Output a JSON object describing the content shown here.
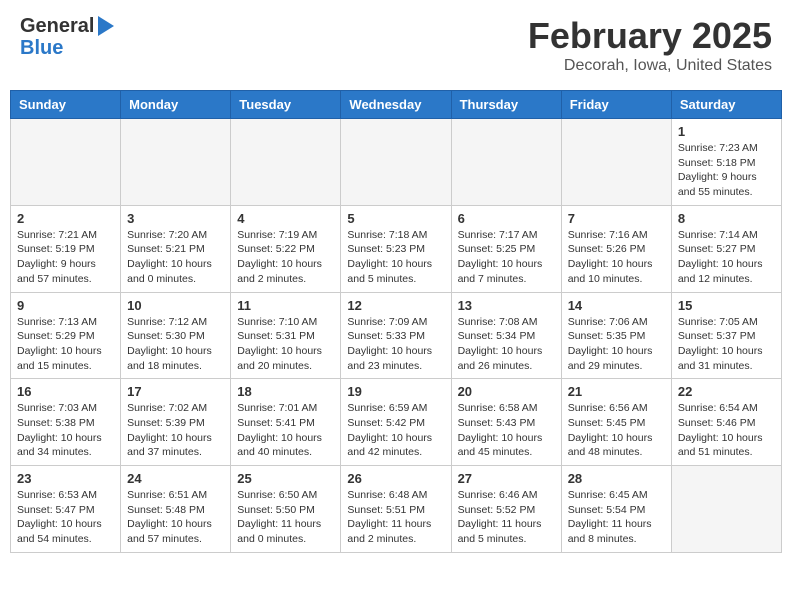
{
  "logo": {
    "line1": "General",
    "line2": "Blue"
  },
  "title": "February 2025",
  "subtitle": "Decorah, Iowa, United States",
  "days_of_week": [
    "Sunday",
    "Monday",
    "Tuesday",
    "Wednesday",
    "Thursday",
    "Friday",
    "Saturday"
  ],
  "weeks": [
    [
      {
        "day": "",
        "info": ""
      },
      {
        "day": "",
        "info": ""
      },
      {
        "day": "",
        "info": ""
      },
      {
        "day": "",
        "info": ""
      },
      {
        "day": "",
        "info": ""
      },
      {
        "day": "",
        "info": ""
      },
      {
        "day": "1",
        "info": "Sunrise: 7:23 AM\nSunset: 5:18 PM\nDaylight: 9 hours\nand 55 minutes."
      }
    ],
    [
      {
        "day": "2",
        "info": "Sunrise: 7:21 AM\nSunset: 5:19 PM\nDaylight: 9 hours\nand 57 minutes."
      },
      {
        "day": "3",
        "info": "Sunrise: 7:20 AM\nSunset: 5:21 PM\nDaylight: 10 hours\nand 0 minutes."
      },
      {
        "day": "4",
        "info": "Sunrise: 7:19 AM\nSunset: 5:22 PM\nDaylight: 10 hours\nand 2 minutes."
      },
      {
        "day": "5",
        "info": "Sunrise: 7:18 AM\nSunset: 5:23 PM\nDaylight: 10 hours\nand 5 minutes."
      },
      {
        "day": "6",
        "info": "Sunrise: 7:17 AM\nSunset: 5:25 PM\nDaylight: 10 hours\nand 7 minutes."
      },
      {
        "day": "7",
        "info": "Sunrise: 7:16 AM\nSunset: 5:26 PM\nDaylight: 10 hours\nand 10 minutes."
      },
      {
        "day": "8",
        "info": "Sunrise: 7:14 AM\nSunset: 5:27 PM\nDaylight: 10 hours\nand 12 minutes."
      }
    ],
    [
      {
        "day": "9",
        "info": "Sunrise: 7:13 AM\nSunset: 5:29 PM\nDaylight: 10 hours\nand 15 minutes."
      },
      {
        "day": "10",
        "info": "Sunrise: 7:12 AM\nSunset: 5:30 PM\nDaylight: 10 hours\nand 18 minutes."
      },
      {
        "day": "11",
        "info": "Sunrise: 7:10 AM\nSunset: 5:31 PM\nDaylight: 10 hours\nand 20 minutes."
      },
      {
        "day": "12",
        "info": "Sunrise: 7:09 AM\nSunset: 5:33 PM\nDaylight: 10 hours\nand 23 minutes."
      },
      {
        "day": "13",
        "info": "Sunrise: 7:08 AM\nSunset: 5:34 PM\nDaylight: 10 hours\nand 26 minutes."
      },
      {
        "day": "14",
        "info": "Sunrise: 7:06 AM\nSunset: 5:35 PM\nDaylight: 10 hours\nand 29 minutes."
      },
      {
        "day": "15",
        "info": "Sunrise: 7:05 AM\nSunset: 5:37 PM\nDaylight: 10 hours\nand 31 minutes."
      }
    ],
    [
      {
        "day": "16",
        "info": "Sunrise: 7:03 AM\nSunset: 5:38 PM\nDaylight: 10 hours\nand 34 minutes."
      },
      {
        "day": "17",
        "info": "Sunrise: 7:02 AM\nSunset: 5:39 PM\nDaylight: 10 hours\nand 37 minutes."
      },
      {
        "day": "18",
        "info": "Sunrise: 7:01 AM\nSunset: 5:41 PM\nDaylight: 10 hours\nand 40 minutes."
      },
      {
        "day": "19",
        "info": "Sunrise: 6:59 AM\nSunset: 5:42 PM\nDaylight: 10 hours\nand 42 minutes."
      },
      {
        "day": "20",
        "info": "Sunrise: 6:58 AM\nSunset: 5:43 PM\nDaylight: 10 hours\nand 45 minutes."
      },
      {
        "day": "21",
        "info": "Sunrise: 6:56 AM\nSunset: 5:45 PM\nDaylight: 10 hours\nand 48 minutes."
      },
      {
        "day": "22",
        "info": "Sunrise: 6:54 AM\nSunset: 5:46 PM\nDaylight: 10 hours\nand 51 minutes."
      }
    ],
    [
      {
        "day": "23",
        "info": "Sunrise: 6:53 AM\nSunset: 5:47 PM\nDaylight: 10 hours\nand 54 minutes."
      },
      {
        "day": "24",
        "info": "Sunrise: 6:51 AM\nSunset: 5:48 PM\nDaylight: 10 hours\nand 57 minutes."
      },
      {
        "day": "25",
        "info": "Sunrise: 6:50 AM\nSunset: 5:50 PM\nDaylight: 11 hours\nand 0 minutes."
      },
      {
        "day": "26",
        "info": "Sunrise: 6:48 AM\nSunset: 5:51 PM\nDaylight: 11 hours\nand 2 minutes."
      },
      {
        "day": "27",
        "info": "Sunrise: 6:46 AM\nSunset: 5:52 PM\nDaylight: 11 hours\nand 5 minutes."
      },
      {
        "day": "28",
        "info": "Sunrise: 6:45 AM\nSunset: 5:54 PM\nDaylight: 11 hours\nand 8 minutes."
      },
      {
        "day": "",
        "info": ""
      }
    ]
  ]
}
